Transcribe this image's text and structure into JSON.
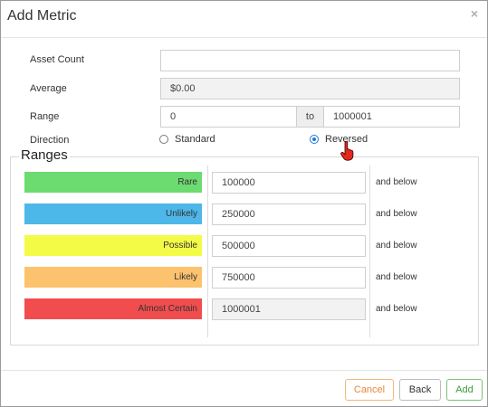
{
  "dialog": {
    "title": "Add Metric",
    "close_glyph": "×"
  },
  "form": {
    "asset_count": {
      "label": "Asset Count",
      "value": ""
    },
    "average": {
      "label": "Average",
      "value": "$0.00"
    },
    "range": {
      "label": "Range",
      "from": "0",
      "to_label": "to",
      "to": "1000001"
    },
    "direction": {
      "label": "Direction",
      "options": [
        {
          "label": "Standard",
          "selected": false
        },
        {
          "label": "Reversed",
          "selected": true
        }
      ]
    }
  },
  "ranges": {
    "title": "Ranges",
    "suffix": "and below",
    "bands": [
      {
        "name": "Rare",
        "value": "100000",
        "color": "#6cdb70",
        "readonly": false
      },
      {
        "name": "Unlikely",
        "value": "250000",
        "color": "#4cb7e8",
        "readonly": false
      },
      {
        "name": "Possible",
        "value": "500000",
        "color": "#f4fb46",
        "readonly": false
      },
      {
        "name": "Likely",
        "value": "750000",
        "color": "#fcc26e",
        "readonly": false
      },
      {
        "name": "Almost Certain",
        "value": "1000001",
        "color": "#f14d4f",
        "readonly": true
      }
    ]
  },
  "footer": {
    "cancel": "Cancel",
    "back": "Back",
    "add": "Add"
  },
  "icons": {
    "cursor": "hand-pointer-icon"
  }
}
